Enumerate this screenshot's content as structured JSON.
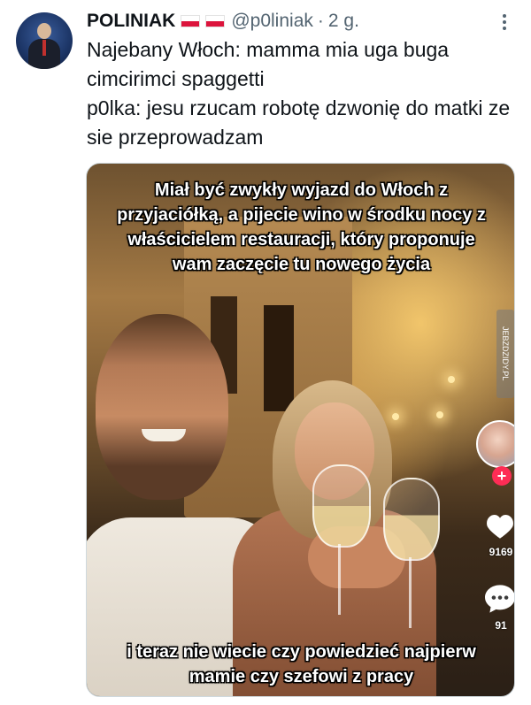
{
  "tweet": {
    "display_name": "POLINIAK",
    "handle": "@p0liniak",
    "separator": "·",
    "time": "2 g.",
    "text_lines": [
      "Najebany Włoch: mamma mia uga buga cimcirimci spaggetti",
      "p0lka: jesu rzucam robotę dzwonię do matki ze sie przeprowadzam"
    ]
  },
  "media": {
    "caption_top": [
      "Miał być zwykły wyjazd do Włoch z",
      "przyjaciółką, a pijecie wino w środku nocy z",
      "właścicielem restauracji, który proponuje",
      "wam zaczęcie tu nowego życia"
    ],
    "caption_bottom": [
      "i teraz nie wiecie czy powiedzieć najpierw",
      "mamie czy szefowi z pracy"
    ],
    "watermark": "JEBZDZIDY.PL",
    "like_count": "9169",
    "comment_count": "91",
    "follow_symbol": "+"
  },
  "icons": {
    "more": "more-vertical-icon",
    "flag": "poland-flag-icon",
    "heart": "heart-icon",
    "comment": "comment-icon"
  },
  "colors": {
    "text_primary": "#0f1419",
    "text_secondary": "#536471",
    "follow_red": "#fe2c55"
  }
}
